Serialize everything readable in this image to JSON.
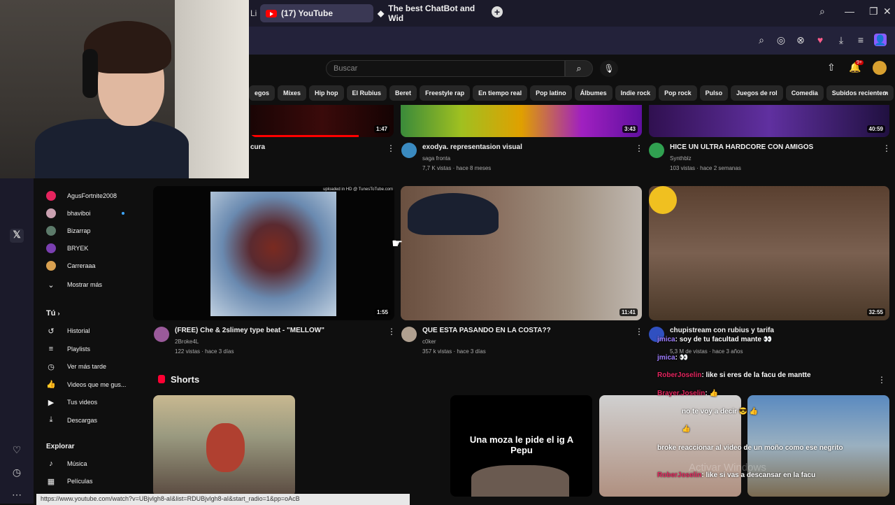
{
  "browser": {
    "tab_active": "(17) YouTube",
    "tab_second": "The best ChatBot and Wid",
    "tab_partial": "Li",
    "new_tab": "+"
  },
  "search": {
    "placeholder": "Buscar"
  },
  "notifications_count": "9+",
  "chips": [
    "egos",
    "Mixes",
    "Hip hop",
    "El Rubius",
    "Beret",
    "Freestyle rap",
    "En tiempo real",
    "Pop latino",
    "Álbumes",
    "Indie rock",
    "Pop rock",
    "Pulso",
    "Juegos de rol",
    "Comedia",
    "Subidos recientem"
  ],
  "sidebar": {
    "subs": [
      {
        "label": "AgusFortnite2008",
        "color": "#e5245e",
        "dot": false
      },
      {
        "label": "bhaviboi",
        "color": "#c9a0b0",
        "dot": true
      },
      {
        "label": "Bizarrap",
        "color": "#5c7a6a",
        "dot": false
      },
      {
        "label": "BRYEK",
        "color": "#7a3fb0",
        "dot": false
      },
      {
        "label": "Carreraaa",
        "color": "#d8a050",
        "dot": false
      }
    ],
    "show_more": "Mostrar más",
    "you_header": "Tú",
    "you_items": [
      {
        "label": "Historial",
        "icon": "history-icon",
        "glyph": "↺"
      },
      {
        "label": "Playlists",
        "icon": "playlist-icon",
        "glyph": "≡"
      },
      {
        "label": "Ver más tarde",
        "icon": "clock-icon",
        "glyph": "◷"
      },
      {
        "label": "Videos que me gus...",
        "icon": "like-icon",
        "glyph": "👍"
      },
      {
        "label": "Tus videos",
        "icon": "video-icon",
        "glyph": "▶"
      },
      {
        "label": "Descargas",
        "icon": "download-icon",
        "glyph": "⤓"
      }
    ],
    "explore_header": "Explorar",
    "explore_items": [
      {
        "label": "Música",
        "icon": "music-icon",
        "glyph": "♪"
      },
      {
        "label": "Películas",
        "icon": "film-icon",
        "glyph": "▦"
      }
    ]
  },
  "videos_row1": [
    {
      "title": "cura",
      "duration": "1:47"
    },
    {
      "title": "exodya. representasion visual",
      "channel": "saga fronta",
      "meta": "7,7 K vistas · hace 8 meses",
      "duration": "3:43"
    },
    {
      "title": "HICE UN ULTRA HARDCORE CON AMIGOS",
      "channel": "Synthblz",
      "meta": "103 vistas · hace 2 semanas",
      "duration": "40:59"
    }
  ],
  "videos_row2": [
    {
      "title": "(FREE) Che & 2slimey  type beat - \"MELLOW\"",
      "channel": "2Broke4L",
      "meta": "122 vistas · hace 3 días",
      "duration": "1:55",
      "overlay": "uploaded in HD @ TunesToTube.com"
    },
    {
      "title": "QUE ESTA PASANDO EN LA COSTA??",
      "channel": "c0ker",
      "meta": "357 k vistas · hace 3 días",
      "duration": "11:41"
    },
    {
      "title": "chupistream con rubius y tarifa",
      "meta": "5,3 M de vistas · hace 3 años",
      "duration": "32:55"
    }
  ],
  "shorts": {
    "header": "Shorts",
    "short2_caption": "Una moza le pide el ig A Pepu"
  },
  "chat": [
    {
      "user": "jmica",
      "text": "soy de tu facultad mante 👀"
    },
    {
      "user": "jmica",
      "text": "👀"
    },
    {
      "user": "RoberJoselin",
      "text": "like si eres de la facu de mantte"
    },
    {
      "user": "Brayer.Joselin",
      "text": "👍"
    },
    {
      "user": "",
      "text": "no te voy a decir 😎 👍"
    },
    {
      "user": "",
      "text": "👍"
    },
    {
      "user": "",
      "text": "broke reaccionar al video de un moño como ese negrito"
    },
    {
      "user": "RoberJoselin",
      "text": "like si vas a descansar en la facu"
    }
  ],
  "status_url": "https://www.youtube.com/watch?v=UBjvlgh8-aI&list=RDUBjvlgh8-aI&start_radio=1&pp=oAcB",
  "watermark": "Activar Windows"
}
